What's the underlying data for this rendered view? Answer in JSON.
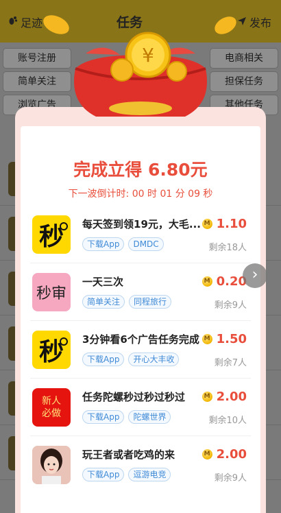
{
  "topbar": {
    "left_label": "足迹",
    "title": "任务",
    "right_label": "发布"
  },
  "categories": [
    "账号注册",
    "电商相关",
    "简单关注",
    "担保任务",
    "浏览广告",
    "其他任务"
  ],
  "popup": {
    "headline": "完成立得 6.80元",
    "countdown": "下一波倒计时: 00 时 01 分 09 秒"
  },
  "tasks": [
    {
      "icon_text": "秒",
      "icon_bg": "#ffd800",
      "title": "每天签到领19元，大毛...",
      "tags": [
        "下载App",
        "DMDC"
      ],
      "price": "1.10",
      "remain": "剩余18人"
    },
    {
      "icon_text": "秒审",
      "icon_bg": "#f7a8c1",
      "title": "一天三次",
      "tags": [
        "简单关注",
        "同程旅行"
      ],
      "price": "0.20",
      "remain": "剩余9人"
    },
    {
      "icon_text": "秒",
      "icon_bg": "#ffd800",
      "title": "3分钟看6个广告任务完成",
      "tags": [
        "下载App",
        "开心大丰收"
      ],
      "price": "1.50",
      "remain": "剩余7人"
    },
    {
      "icon_text": "新人必做",
      "icon_bg": "#e5140f",
      "title": "任务陀螺秒过秒过秒过",
      "tags": [
        "下载App",
        "陀螺世界"
      ],
      "price": "2.00",
      "remain": "剩余10人"
    },
    {
      "icon_text": "",
      "icon_bg": "#e9c3b8",
      "title": "玩王者或者吃鸡的来",
      "tags": [
        "下载App",
        "逗游电竞"
      ],
      "price": "2.00",
      "remain": "剩余9人"
    }
  ],
  "colors": {
    "accent_red": "#e84e3b",
    "tag_blue": "#3f8ad6"
  },
  "icons": {
    "coin": "M",
    "next": "›"
  }
}
